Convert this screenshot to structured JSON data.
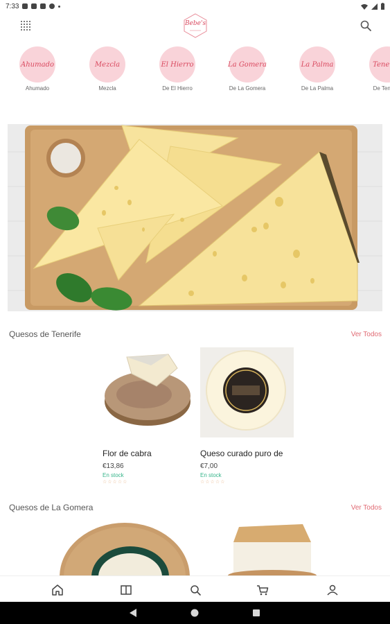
{
  "status_bar": {
    "time": "7:33"
  },
  "header": {
    "logo_text": "Bebe's",
    "grid_icon": "grid-icon",
    "search_icon": "search-icon"
  },
  "categories": [
    {
      "script": "Ahumado",
      "label": "Ahumado"
    },
    {
      "script": "Mezcla",
      "label": "Mezcla"
    },
    {
      "script": "El Hierro",
      "label": "De El Hierro"
    },
    {
      "script": "La Gomera",
      "label": "De La Gomera"
    },
    {
      "script": "La Palma",
      "label": "De La Palma"
    },
    {
      "script": "Tenerife",
      "label": "De Tenerife"
    }
  ],
  "sections": [
    {
      "title": "Quesos de Tenerife",
      "see_all": "Ver Todos",
      "products": [
        {
          "name": "Flor de cabra",
          "price": "€13,86",
          "stock": "En stock",
          "rating": 0
        },
        {
          "name": "Queso curado puro de",
          "price": "€7,00",
          "stock": "En stock",
          "rating": 0
        }
      ]
    },
    {
      "title": "Quesos de La Gomera",
      "see_all": "Ver Todos"
    }
  ],
  "bottom_nav": [
    {
      "icon": "home-icon",
      "active": true
    },
    {
      "icon": "catalog-icon",
      "active": false
    },
    {
      "icon": "search-icon",
      "active": false
    },
    {
      "icon": "cart-icon",
      "active": false
    },
    {
      "icon": "profile-icon",
      "active": false
    }
  ],
  "colors": {
    "accent": "#d9485e",
    "category_bg": "#f9d3d9",
    "stock": "#36b48a",
    "see_all": "#e06a73"
  }
}
